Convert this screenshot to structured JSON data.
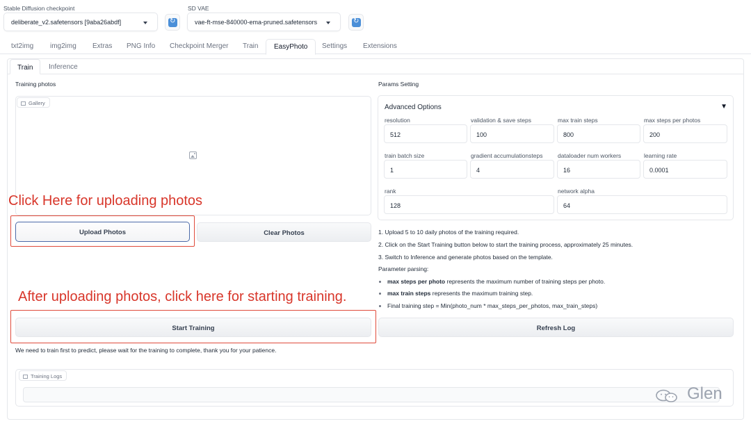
{
  "header": {
    "checkpoint_label": "Stable Diffusion checkpoint",
    "checkpoint_value": "deliberate_v2.safetensors [9aba26abdf]",
    "vae_label": "SD VAE",
    "vae_value": "vae-ft-mse-840000-ema-pruned.safetensors"
  },
  "tabs": [
    "txt2img",
    "img2img",
    "Extras",
    "PNG Info",
    "Checkpoint Merger",
    "Train",
    "EasyPhoto",
    "Settings",
    "Extensions"
  ],
  "active_tab": "EasyPhoto",
  "subtabs": [
    "Train",
    "Inference"
  ],
  "left": {
    "section_title": "Training photos",
    "gallery_label": "Gallery",
    "upload_button": "Upload Photos",
    "clear_button": "Clear Photos",
    "start_button": "Start Training",
    "wait_note": "We need to train first to predict, please wait for the training to complete, thank you for your patience.",
    "logs_label": "Training Logs"
  },
  "annotations": {
    "upload_hint": "Click Here for uploading photos",
    "train_hint": "After uploading photos, click here for starting training."
  },
  "right": {
    "section_title": "Params Setting",
    "advanced_title": "Advanced Options",
    "params": [
      {
        "label": "resolution",
        "value": "512"
      },
      {
        "label": "validation & save steps",
        "value": "100"
      },
      {
        "label": "max train steps",
        "value": "800"
      },
      {
        "label": "max steps per photos",
        "value": "200"
      },
      {
        "label": "train batch size",
        "value": "1"
      },
      {
        "label": "gradient accumulationsteps",
        "value": "4"
      },
      {
        "label": "dataloader num workers",
        "value": "16"
      },
      {
        "label": "learning rate",
        "value": "0.0001"
      },
      {
        "label": "rank",
        "value": "128"
      },
      {
        "label": "network alpha",
        "value": "64"
      }
    ],
    "steps": [
      "1. Upload 5 to 10 daily photos of the training required.",
      "2. Click on the Start Training button below to start the training process, approximately 25 minutes.",
      "3. Switch to Inference and generate photos based on the template."
    ],
    "param_parsing_title": "Parameter parsing:",
    "bullets": [
      {
        "bold": "max steps per photo",
        "rest": " represents the maximum number of training steps per photo."
      },
      {
        "bold": "max train steps",
        "rest": " represents the maximum training step."
      },
      {
        "bold": "",
        "rest": "Final training step = Min(photo_num * max_steps_per_photos, max_train_steps)"
      }
    ],
    "refresh_button": "Refresh Log"
  },
  "watermark": "Glen",
  "colors": {
    "annotation": "#d8362a",
    "refresh_icon": "#4b8fd8"
  }
}
